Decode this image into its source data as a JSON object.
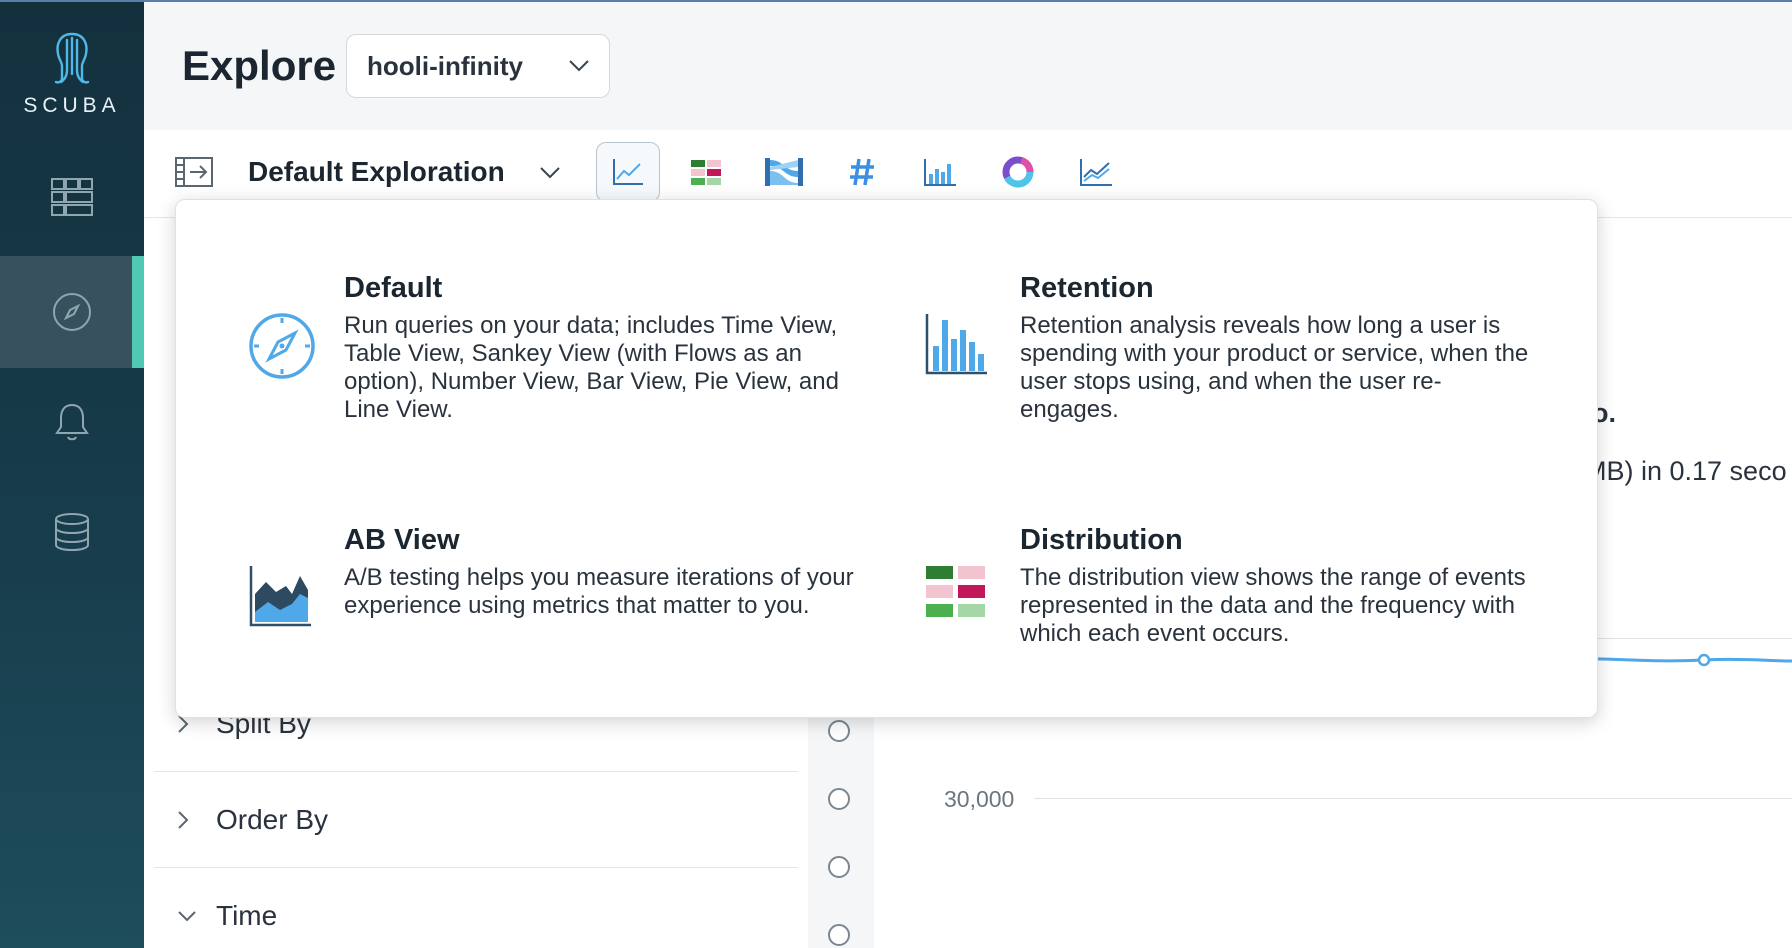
{
  "app": {
    "logo_text": "SCUBA"
  },
  "sidebar": {
    "items": [
      {
        "name": "dashboards",
        "icon": "grid-icon",
        "active": false
      },
      {
        "name": "explore",
        "icon": "compass-icon",
        "active": true
      },
      {
        "name": "alerts",
        "icon": "bell-icon",
        "active": false
      },
      {
        "name": "data",
        "icon": "database-icon",
        "active": false
      }
    ]
  },
  "header": {
    "title": "Explore",
    "dataset": "hooli-infinity"
  },
  "toolbar": {
    "exploration_title": "Default Exploration",
    "views": [
      {
        "name": "time-view",
        "icon": "line-chart-icon",
        "active": true
      },
      {
        "name": "table-view",
        "icon": "table-grid-icon",
        "active": false
      },
      {
        "name": "sankey-view",
        "icon": "sankey-icon",
        "active": false
      },
      {
        "name": "number-view",
        "icon": "hash-icon",
        "active": false
      },
      {
        "name": "bar-view",
        "icon": "bar-chart-icon",
        "active": false
      },
      {
        "name": "pie-view",
        "icon": "donut-icon",
        "active": false
      },
      {
        "name": "line-view",
        "icon": "trend-line-icon",
        "active": false
      }
    ]
  },
  "exploration_types": [
    {
      "title": "Default",
      "description": "Run queries on your data; includes Time View, Table View, Sankey View (with Flows as an option), Number View, Bar View, Pie View, and Line View.",
      "icon": "compass-icon"
    },
    {
      "title": "Retention",
      "description": "Retention analysis reveals how long a user is spending with your product or service, when the user stops using, and when the user re-engages.",
      "icon": "bar-chart-icon"
    },
    {
      "title": "AB View",
      "description": "A/B testing helps you measure iterations of your experience using metrics that matter to you.",
      "icon": "area-chart-icon"
    },
    {
      "title": "Distribution",
      "description": "The distribution view shows the range of events represented in the data and the frequency with which each event occurs.",
      "icon": "distribution-grid-icon"
    }
  ],
  "query_panel": {
    "sections": [
      {
        "label": "Split By",
        "expanded": false
      },
      {
        "label": "Order By",
        "expanded": false
      },
      {
        "label": "Time",
        "expanded": true
      }
    ]
  },
  "chart_fragments": {
    "text_1": "o.",
    "text_2": "MB) in 0.17 seco",
    "y_tick": "30,000"
  },
  "colors": {
    "accent": "#4fc9b3",
    "icon_blue": "#4fa8e8",
    "sidebar_bg": "#173c4b"
  }
}
